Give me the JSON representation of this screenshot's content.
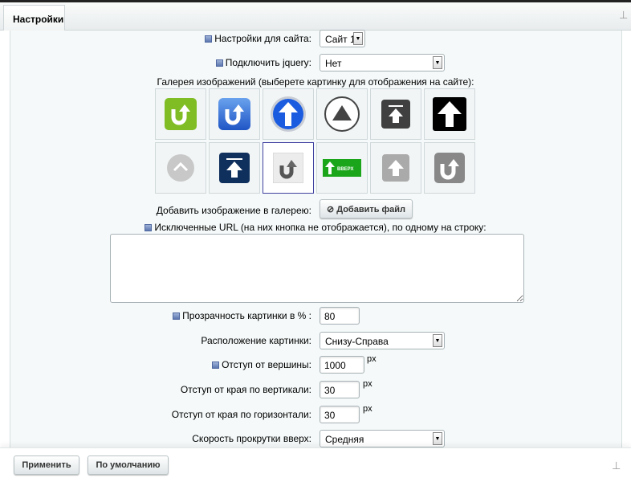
{
  "tab": {
    "label": "Настройки"
  },
  "site_settings": {
    "label": "Настройки для сайта:",
    "value": "Сайт 1"
  },
  "jquery": {
    "label": "Подключить jquery:",
    "value": "Нет"
  },
  "gallery": {
    "label": "Галерея изображений (выберете картинку для отображения на сайте):",
    "selected_index": 8,
    "items": [
      "green-u-turn-arrow",
      "blue-u-turn-arrow",
      "blue-orb-arrow",
      "circle-triangle",
      "dark-top-arrow",
      "black-arrow",
      "gray-circle-chevron",
      "navy-top-arrow",
      "gray-u-turn-arrow",
      "green-up-button",
      "light-gray-arrow",
      "gray-u-turn-square"
    ],
    "up_button_text": "ВВЕРХ"
  },
  "add_image": {
    "label": "Добавить изображение в галерею:",
    "button": "Добавить файл"
  },
  "excluded": {
    "label": "Исключенные URL (на них кнопка не отображается), по одному на строку:",
    "value": ""
  },
  "opacity": {
    "label": "Прозрачность картинки в % :",
    "value": "80"
  },
  "position": {
    "label": "Расположение картинки:",
    "value": "Снизу-Справа"
  },
  "top_offset": {
    "label": "Отступ от вершины:",
    "value": "1000",
    "unit": "px"
  },
  "v_offset": {
    "label": "Отступ от края по вертикали:",
    "value": "30",
    "unit": "px"
  },
  "h_offset": {
    "label": "Отступ от края по горизонтали:",
    "value": "30",
    "unit": "px"
  },
  "speed": {
    "label": "Скорость прокрутки вверх:",
    "value": "Средняя"
  },
  "footer": {
    "apply": "Применить",
    "default": "По умолчанию"
  }
}
